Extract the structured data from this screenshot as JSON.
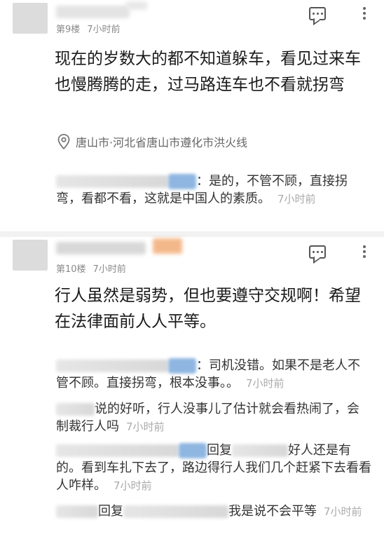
{
  "comments": [
    {
      "floor": "第9楼",
      "time": "7小时前",
      "text": "现在的岁数大的都不知道躲车，看见过来车也慢腾腾的走，过马路连车也不看就拐弯",
      "location": "唐山市·河北省唐山市遵化市洪火线",
      "replies": [
        {
          "text": "：是的，不管不顾，直接拐弯，看都不看，这就是中国人的素质。",
          "time": "7小时前"
        }
      ]
    },
    {
      "floor": "第10楼",
      "time": "7小时前",
      "text": "行人虽然是弱势，但也要遵守交规啊！希望在法律面前人人平等。",
      "replies": [
        {
          "text": "：司机没错。如果不是老人不管不顾。直接拐弯，根本没事。。",
          "time": "7小时前"
        },
        {
          "text": "说的好听，行人没事儿了估计就会看热闹了，会制裁行人吗",
          "time": "7小时前"
        },
        {
          "prefix": "回复",
          "text": "好人还是有的。看到车扎下去了，路边得行人我们几个赶紧下去看看人咋样。",
          "time": "7小时前"
        },
        {
          "prefix": "回复",
          "text": "我是说不会平等",
          "time": "7小时前"
        }
      ]
    }
  ],
  "icons": [
    "chat-icon",
    "more-icon",
    "location-icon"
  ],
  "colors": {
    "blur_tag_blue": "#8fb6e0",
    "blur_tag_orange": "#f3b88a"
  }
}
